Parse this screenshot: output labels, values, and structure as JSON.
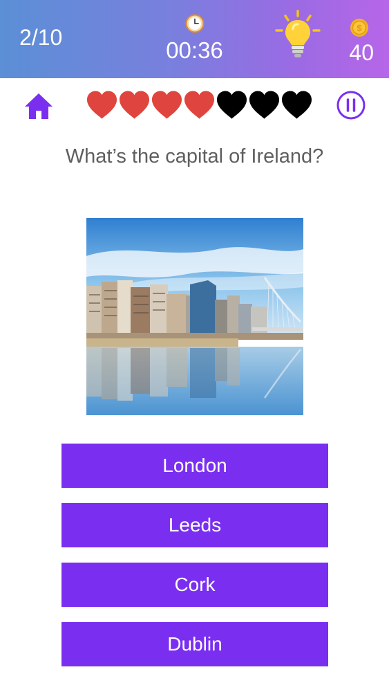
{
  "header": {
    "progress": "2/10",
    "timer": "00:36",
    "coins": "40",
    "icons": {
      "timer": "clock-icon",
      "hint": "lightbulb-icon",
      "coin": "coin-icon"
    }
  },
  "controls": {
    "home_icon": "home-icon",
    "pause_icon": "pause-icon"
  },
  "lives": {
    "remaining": 4,
    "total": 7,
    "colors": {
      "full": "#e0443e",
      "lost": "#000000"
    }
  },
  "question": {
    "text": "What’s the capital of Ireland?",
    "image": "dublin-river-cityscape"
  },
  "answers": [
    {
      "label": "London"
    },
    {
      "label": "Leeds"
    },
    {
      "label": "Cork"
    },
    {
      "label": "Dublin"
    }
  ],
  "colors": {
    "answer_button": "#7a2ff0",
    "accent": "#7a2ff0",
    "question_text": "#5f5f5f"
  }
}
